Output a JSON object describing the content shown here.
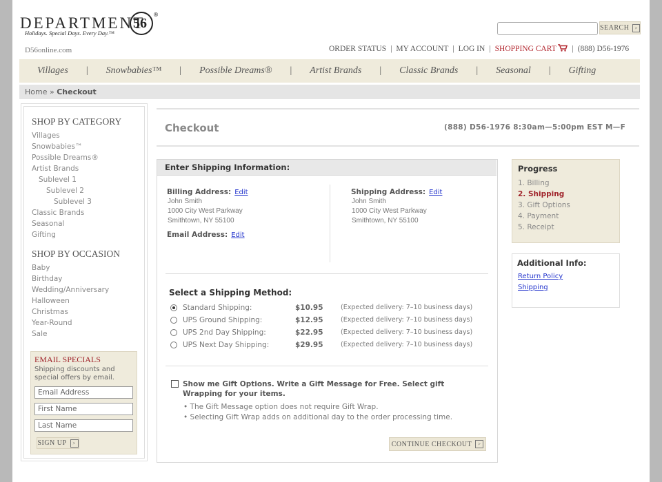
{
  "header": {
    "logo_word": "DEPARTMENT",
    "logo_tagline": "Holidays. Special Days. Every Day.™",
    "logo_mark": "56",
    "logo_reg": "®",
    "site_url": "D56online.com",
    "search_placeholder": "",
    "search_label": "SEARCH",
    "utility": [
      "ORDER STATUS",
      "MY ACCOUNT",
      "LOG IN",
      "SHOPPING CART",
      "(888) D56-1976"
    ]
  },
  "nav": [
    "Villages",
    "Snowbabies™",
    "Possible Dreams®",
    "Artist Brands",
    "Classic Brands",
    "Seasonal",
    "Gifting"
  ],
  "breadcrumb": {
    "home": "Home",
    "sep": "»",
    "current": "Checkout"
  },
  "sidebar": {
    "category_title": "SHOP BY CATEGORY",
    "categories": [
      "Villages",
      "Snowbabies™",
      "Possible Dreams®",
      "Artist Brands",
      "Sublevel 1",
      "Sublevel 2",
      "Sublevel 3",
      "Classic Brands",
      "Seasonal",
      "Gifting"
    ],
    "occasion_title": "SHOP BY OCCASION",
    "occasions": [
      "Baby",
      "Birthday",
      "Wedding/Anniversary",
      "Halloween",
      "Christmas",
      "Year-Round",
      "Sale"
    ],
    "email": {
      "title": "EMAIL SPECIALS",
      "desc": "Shipping discounts and special offers by email.",
      "email_value": "Email Address",
      "first_value": "First Name",
      "last_value": "Last Name",
      "signup_label": "SIGN UP"
    }
  },
  "checkout": {
    "title": "Checkout",
    "phone": "(888) D56-1976 8:30am—5:00pm EST M—F",
    "panel_title": "Enter Shipping Information:",
    "billing_label": "Billing Address:",
    "shipping_label": "Shipping Address:",
    "email_label": "Email Address:",
    "edit_label": "Edit",
    "billing_addr": [
      "John Smith",
      "1000 City West Parkway",
      "Smithtown, NY 55100"
    ],
    "shipping_addr": [
      "John Smith",
      "1000 City West Parkway",
      "Smithtown, NY 55100"
    ],
    "method_title": "Select a Shipping Method:",
    "methods": [
      {
        "name": "Standard Shipping:",
        "price": "$10.95",
        "delivery": "(Expected delivery: 7–10 business days)"
      },
      {
        "name": "UPS Ground Shipping:",
        "price": "$12.95",
        "delivery": "(Expected delivery: 7–10 business days)"
      },
      {
        "name": "UPS 2nd Day Shipping:",
        "price": "$22.95",
        "delivery": "(Expected delivery: 7–10 business days)"
      },
      {
        "name": "UPS Next Day Shipping:",
        "price": "$29.95",
        "delivery": "(Expected delivery: 7–10 business days)"
      }
    ],
    "gift_label": "Show me Gift Options. Write a Gift Message for Free. Select gift Wrapping for your items.",
    "gift_notes": [
      "• The Gift Message option does not require Gift Wrap.",
      "• Selecting Gift Wrap adds on additional day to the order processing time."
    ],
    "continue_label": "CONTINUE CHECKOUT"
  },
  "progress": {
    "title": "Progress",
    "steps": [
      "1. Billing",
      "2. Shipping",
      "3. Gift Options",
      "4. Payment",
      "5. Receipt"
    ]
  },
  "additional": {
    "title": "Additional Info:",
    "links": [
      "Return Policy",
      "Shipping"
    ]
  },
  "colors": {
    "accent_red": "#a0242b",
    "beige": "#efebdc",
    "link_blue": "#2233cc"
  }
}
